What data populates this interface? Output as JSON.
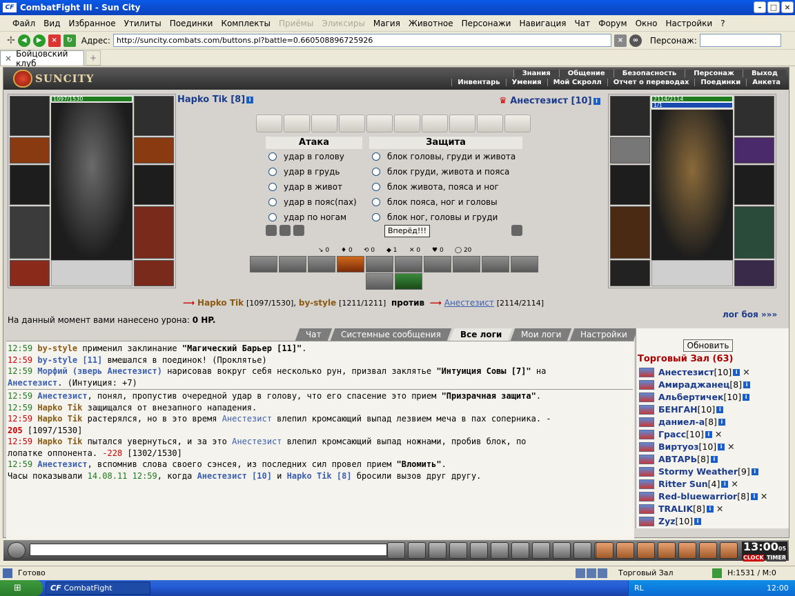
{
  "window": {
    "title": "CombatFight III - Sun City",
    "logo": "CF",
    "buttons": [
      "minimize",
      "maximize",
      "close"
    ]
  },
  "menu": {
    "items": [
      {
        "label": "Файл",
        "enabled": true
      },
      {
        "label": "Вид",
        "enabled": true
      },
      {
        "label": "Избранное",
        "enabled": true
      },
      {
        "label": "Утилиты",
        "enabled": true
      },
      {
        "label": "Поединки",
        "enabled": true
      },
      {
        "label": "Комплекты",
        "enabled": true
      },
      {
        "label": "Приёмы",
        "enabled": false
      },
      {
        "label": "Эликсиры",
        "enabled": false
      },
      {
        "label": "Магия",
        "enabled": true
      },
      {
        "label": "Животное",
        "enabled": true
      },
      {
        "label": "Персонажи",
        "enabled": true
      },
      {
        "label": "Навигация",
        "enabled": true
      },
      {
        "label": "Чат",
        "enabled": true
      },
      {
        "label": "Форум",
        "enabled": true
      },
      {
        "label": "Окно",
        "enabled": true
      },
      {
        "label": "Настройки",
        "enabled": true
      },
      {
        "label": "?",
        "enabled": true
      }
    ]
  },
  "address": {
    "label": "Адрес:",
    "url": "http://suncity.combats.com/buttons.pl?battle=0.660508896725926",
    "character_label": "Персонаж:"
  },
  "tab": {
    "title": "Бойцовский клуб",
    "new": "+"
  },
  "header": {
    "logo": "SUNCITY",
    "nav_top": [
      "Знания",
      "Общение",
      "Безопасность",
      "Персонаж",
      "Выход"
    ],
    "nav_bottom": [
      "Инвентарь",
      "Умения",
      "Мой Скролл",
      "Отчет о переводах",
      "Поединки",
      "Анкета"
    ]
  },
  "player": {
    "name": "Hapko Tik",
    "level": "[8]",
    "hp": "1097/1530"
  },
  "enemy": {
    "name": "Анестезист",
    "level": "[10]",
    "hp": "2114/2114",
    "mana": "1/1"
  },
  "combat": {
    "attack_header": "Атака",
    "defense_header": "Защита",
    "attacks": [
      "удар в голову",
      "удар в грудь",
      "удар в живот",
      "удар в пояс(пах)",
      "удар по ногам"
    ],
    "blocks": [
      "блок головы, груди и живота",
      "блок груди, живота и пояса",
      "блок живота, пояса и ног",
      "блок пояса, ног и головы",
      "блок ног, головы и груди"
    ],
    "go_button": "Вперёд!!!",
    "stats": [
      "0",
      "0",
      "0",
      "1",
      "0",
      "0",
      "20"
    ]
  },
  "vs": {
    "p1": "Hapko Tik",
    "p1hp": "[1097/1530]",
    "p2": "by-style",
    "p2hp": "[1211/1211]",
    "against": "против",
    "p3": "Анестезист",
    "p3hp": "[2114/2114]"
  },
  "damage": {
    "prefix": "На данный момент вами нанесено урона:",
    "value": "0 HP."
  },
  "log_link": "лог боя »»»",
  "log_tabs": [
    "Чат",
    "Системные сообщения",
    "Все логи",
    "Мои логи",
    "Настройки"
  ],
  "chat": [
    {
      "time": "12:59",
      "actor": "by-style",
      "text": " применил заклинание ",
      "bold": "\"Магический Барьер [11]\"",
      "end": "."
    },
    {
      "time": "12:59",
      "actor": "by-style [11]",
      "text": " вмешался в поединок! (Проклятье)"
    },
    {
      "time": "12:59",
      "actor": "Морфий (зверь Анестезист)",
      "text": " нарисовав вокруг себя несколько рун, призвал заклятье ",
      "bold": "\"Интуиция Совы [7]\"",
      "end": " на"
    },
    {
      "cont": "Анестезист",
      "text": ". (Интуиция: +7)"
    },
    {
      "time": "12:59",
      "actor": "Анестезист",
      "text": ", понял, пропустив очередной удар в голову, что его спасение это прием ",
      "bold": "\"Призрачная защита\"",
      "end": "."
    },
    {
      "time": "12:59",
      "actor": "Hapko Tik",
      "text": " защищался от внезапного нападения."
    },
    {
      "time": "12:59",
      "actor": "Hapko Tik",
      "text": " растерялся, но в это время ",
      "target": "Анестезист",
      "text2": " влепил кромсающий выпад лезвием меча в пах соперника. -"
    },
    {
      "cont": "205",
      "text": " [1097/1530]"
    },
    {
      "time": "12:59",
      "actor": "Hapko Tik",
      "text": " пытался увернуться, и за это ",
      "target": "Анестезист",
      "text2": " влепил кромсающий выпад ножнами, пробив блок, по"
    },
    {
      "cont": "лопатке оппонента.",
      "dmg": "-228",
      "text": " [1302/1530]"
    },
    {
      "time": "12:59",
      "actor": "Анестезист",
      "text": ", вспомнив слова своего сэнсея, из последних сил провел прием ",
      "bold": "\"Вломить\"",
      "end": "."
    },
    {
      "clock": "Часы показывали",
      "date": "14.08.11 12:59",
      "text": ", когда ",
      "p1": "Анестезист [10]",
      "p2": "Hapko Tik [8]",
      "end": " бросили вызов друг другу."
    }
  ],
  "side": {
    "refresh": "Обновить",
    "room": "Торговый Зал (63)",
    "users": [
      {
        "name": "Анестезист",
        "lvl": "[10]"
      },
      {
        "name": "Амираджанец",
        "lvl": "[8]"
      },
      {
        "name": "Альбертичек",
        "lvl": "[10]"
      },
      {
        "name": "БЕНГАН",
        "lvl": "[10]"
      },
      {
        "name": "даниел-а",
        "lvl": "[8]"
      },
      {
        "name": "Грасс",
        "lvl": "[10]"
      },
      {
        "name": "Виртуоз",
        "lvl": "[10]"
      },
      {
        "name": "АВТАРЬ",
        "lvl": "[8]"
      },
      {
        "name": "Stormy Weather",
        "lvl": "[9]"
      },
      {
        "name": "Ritter Sun",
        "lvl": "[4]"
      },
      {
        "name": "Red-bluewarrior",
        "lvl": "[8]"
      },
      {
        "name": "TRALIK",
        "lvl": "[8]"
      },
      {
        "name": "Zyz",
        "lvl": "[10]"
      }
    ]
  },
  "clock": {
    "time": "13:00",
    "sec": "05",
    "label1": "CLOCK",
    "label2": "TIMER"
  },
  "status": {
    "left": "Готово",
    "room": "Торговый Зал",
    "coords": "H:1531 / M:0"
  },
  "taskbar": {
    "app": "CombatFight",
    "lang": "RL",
    "time": "12:00"
  }
}
